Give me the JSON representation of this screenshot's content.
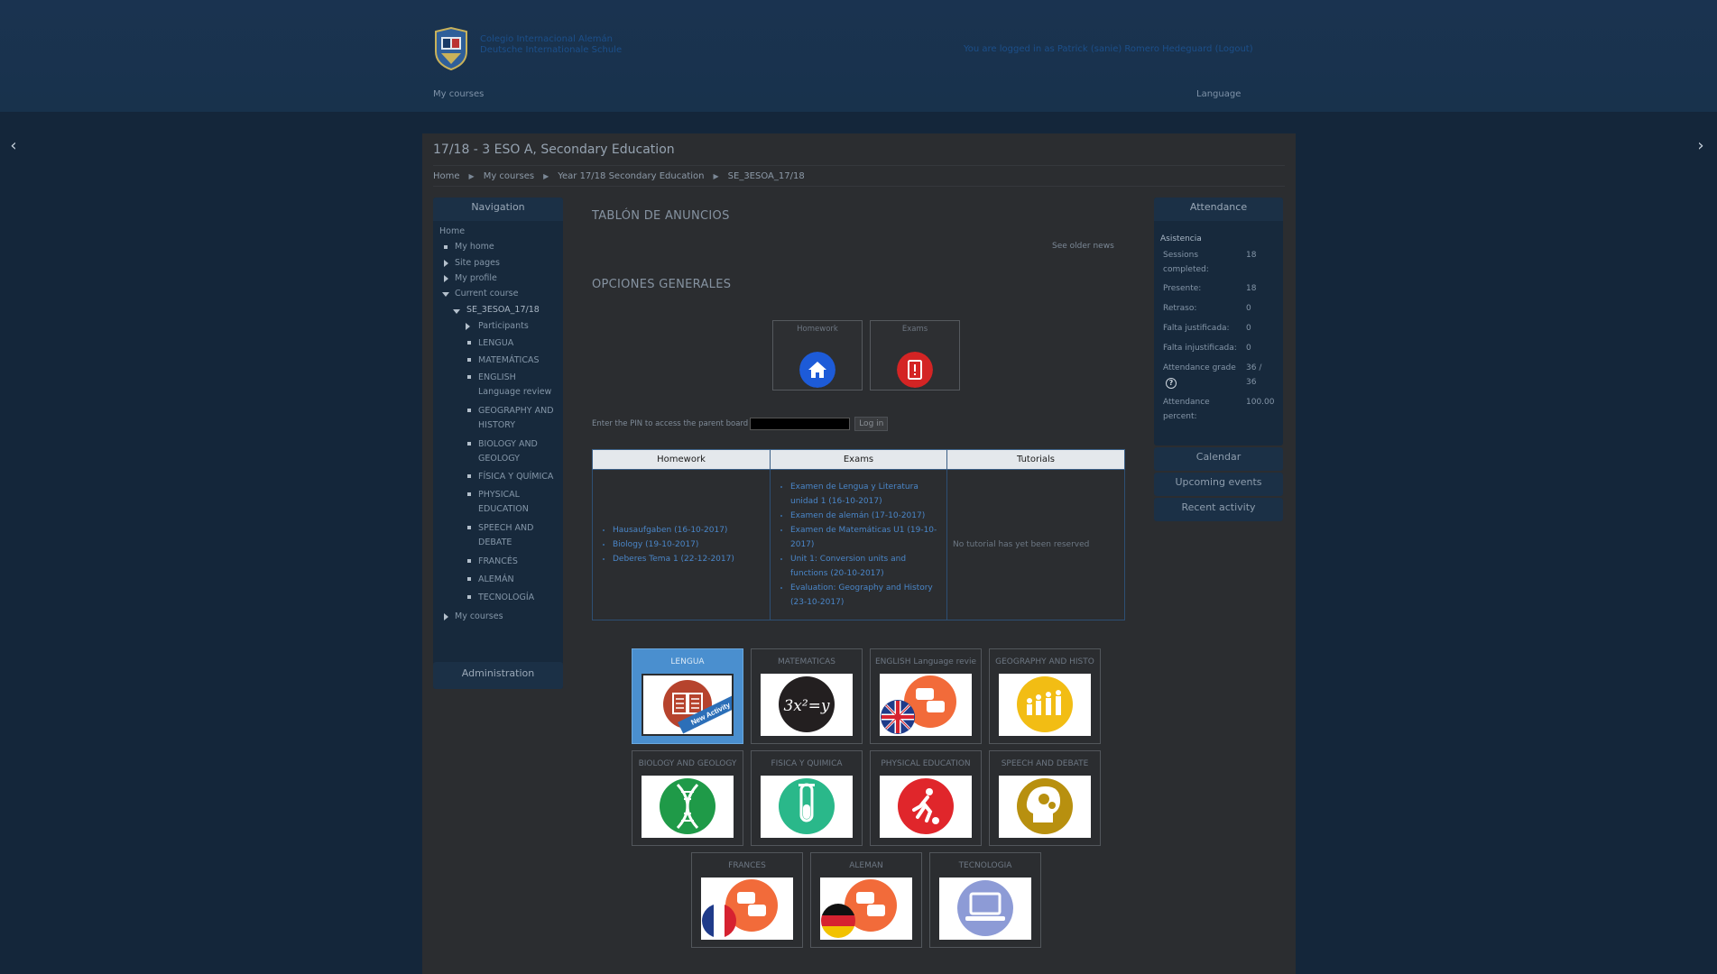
{
  "header": {
    "site_name_line1": "Colegio Internacional Alemán",
    "site_name_line2": "Deutsche Internationale Schule",
    "login_info": "You are logged in as Patrick (sanie) Romero Hedeguard (Logout)",
    "my_courses": "My courses",
    "language": "Language"
  },
  "page": {
    "title": "17/18 - 3 ESO A, Secondary Education",
    "breadcrumb": [
      "Home",
      "My courses",
      "Year 17/18 Secondary Education",
      "SE_3ESOA_17/18"
    ]
  },
  "navigation": {
    "title": "Navigation",
    "home": "Home",
    "my_home": "My home",
    "site_pages": "Site pages",
    "my_profile": "My profile",
    "current_course": "Current course",
    "course_code": "SE_3ESOA_17/18",
    "participants": "Participants",
    "items": [
      "LENGUA",
      "MATEMÁTICAS",
      "ENGLISH Language review",
      "GEOGRAPHY AND HISTORY",
      "BIOLOGY AND GEOLOGY",
      "FÍSICA Y QUÍMICA",
      "PHYSICAL EDUCATION",
      "SPEECH AND DEBATE",
      "FRANCÉS",
      "ALEMÁN",
      "TECNOLOGÍA"
    ],
    "my_courses": "My courses"
  },
  "administration": {
    "title": "Administration"
  },
  "attendance": {
    "title": "Attendance",
    "heading": "Asistencia",
    "rows": [
      {
        "label": "Sessions completed:",
        "value": "18"
      },
      {
        "label": "Presente:",
        "value": "18"
      },
      {
        "label": "Retraso:",
        "value": "0"
      },
      {
        "label": "Falta justificada:",
        "value": "0"
      },
      {
        "label": "Falta injustificada:",
        "value": "0"
      },
      {
        "label": "Attendance grade",
        "value": "36 / 36"
      },
      {
        "label": "Attendance percent:",
        "value": "100.00"
      }
    ]
  },
  "side_blocks": [
    "Calendar",
    "Upcoming events",
    "Recent activity"
  ],
  "main": {
    "news_title": "TABLÓN DE ANUNCIOS",
    "older_news": "See older news",
    "options_title": "OPCIONES GENERALES",
    "options": [
      {
        "label": "Homework",
        "color": "#1d5bd8"
      },
      {
        "label": "Exams",
        "color": "#d42424"
      }
    ],
    "pin_label": "Enter the PIN to access the parent board",
    "pin_button": "Log in"
  },
  "schedule": {
    "headers": [
      "Homework",
      "Exams",
      "Tutorials"
    ],
    "homework": [
      "Hausaufgaben (16-10-2017)",
      "Biology (19-10-2017)",
      "Deberes Tema 1 (22-12-2017)"
    ],
    "exams": [
      "Examen de Lengua y Literatura unidad 1 (16-10-2017)",
      "Examen de alemán (17-10-2017)",
      "Examen de Matemáticas U1 (19-10-2017)",
      "Unit 1: Conversion units and functions (20-10-2017)",
      "Evaluation: Geography and History (23-10-2017)"
    ],
    "tutorials_empty": "No tutorial has yet been reserved"
  },
  "courses": [
    {
      "name": "LENGUA",
      "icon": "book-icon",
      "badge": "New Activity"
    },
    {
      "name": "MATEMÁTICAS",
      "icon": "math-icon",
      "formula": "3x²=y"
    },
    {
      "name": "ENGLISH Language revie",
      "icon": "uk-flag-chat-icon"
    },
    {
      "name": "GEOGRAPHY AND HISTO",
      "icon": "evolution-icon"
    },
    {
      "name": "BIOLOGY AND GEOLOGY",
      "icon": "dna-icon"
    },
    {
      "name": "FÍSICA Y QUÍMICA",
      "icon": "test-tube-icon"
    },
    {
      "name": "PHYSICAL EDUCATION",
      "icon": "runner-icon"
    },
    {
      "name": "SPEECH AND DEBATE",
      "icon": "head-gears-icon"
    },
    {
      "name": "FRANCÉS",
      "icon": "fr-flag-chat-icon"
    },
    {
      "name": "ALEMÁN",
      "icon": "de-flag-chat-icon"
    },
    {
      "name": "TECNOLOGÍA",
      "icon": "computer-icon"
    }
  ],
  "colors": {
    "background": "#14263a",
    "page": "#2b2d30",
    "accent_blue": "#4a8fcf",
    "link": "#4a86c8"
  }
}
